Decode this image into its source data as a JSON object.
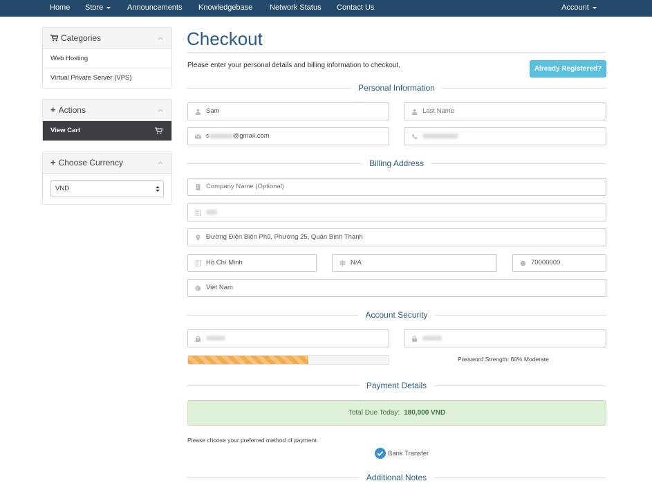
{
  "nav": {
    "home": "Home",
    "store": "Store",
    "announcements": "Announcements",
    "knowledgebase": "Knowledgebase",
    "network_status": "Network Status",
    "contact_us": "Contact Us",
    "account": "Account"
  },
  "sidebar": {
    "categories": {
      "title": "Categories",
      "items": [
        "Web Hosting",
        "Virtual Private Server (VPS)"
      ]
    },
    "actions": {
      "title": "Actions",
      "view_cart": "View Cart"
    },
    "currency": {
      "title": "Choose Currency",
      "selected": "VND"
    }
  },
  "main": {
    "title": "Checkout",
    "intro": "Please enter your personal details and billing information to checkout.",
    "already_registered": "Already Registered?",
    "sections": {
      "personal": "Personal Information",
      "billing": "Billing Address",
      "security": "Account Security",
      "payment": "Payment Details",
      "notes": "Additional Notes"
    },
    "personal": {
      "first_name": "Sam",
      "last_name_placeholder": "Last Name",
      "email_prefix": "s",
      "email_suffix": "@gmail.com"
    },
    "billing": {
      "company_placeholder": "Company Name (Optional)",
      "address2": "Đường Điện Biên Phủ, Phường 25, Quận Bình Thạnh",
      "city": "Hồ Chí Minh",
      "state": "N/A",
      "postcode": "70000000",
      "country": "Viet Nam"
    },
    "security": {
      "strength_text": "Password Strength: 60% Moderate",
      "strength_percent": 60
    },
    "payment": {
      "total_label": "Total Due Today:",
      "total_value": "180,000 VND",
      "choose_method": "Please choose your preferred method of payment.",
      "method": "Bank Transfer"
    }
  },
  "colors": {
    "nav_bg": "#23496b",
    "heading_blue": "#2a5c86",
    "info_button": "#5bc0de",
    "success_bg": "#dff0d8",
    "strength_orange": "#f0ad4e",
    "check_blue": "#3b8fd0"
  }
}
